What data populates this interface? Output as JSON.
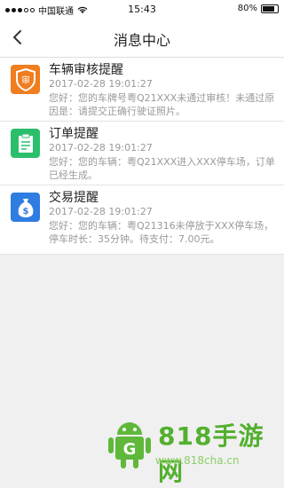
{
  "status": {
    "carrier": "中国联通",
    "time": "15:43",
    "battery": "80%"
  },
  "nav": {
    "title": "消息中心"
  },
  "messages": [
    {
      "title": "车辆审核提醒",
      "time": "2017-02-28 19:01:27",
      "body": "您好：您的车牌号粤Q21XXX未通过审核！未通过原因是：请提交正确行驶证照片。",
      "icon": "shield-audit-icon",
      "color": "#f07d1e"
    },
    {
      "title": "订单提醒",
      "time": "2017-02-28 19:01:27",
      "body": "您好：您的车辆：粤Q21XXX进入XXX停车场，订单已经生成。",
      "icon": "clipboard-icon",
      "color": "#2bbf6b"
    },
    {
      "title": "交易提醒",
      "time": "2017-02-28 19:01:27",
      "body": "您好：您的车辆：粤Q21316未停放于XXX停车场，停车时长：35分钟。待支付：7.00元。",
      "icon": "money-bag-icon",
      "color": "#2f7de1"
    }
  ],
  "watermark": {
    "brand": "818手游网",
    "url": "www.818cha.cn"
  }
}
